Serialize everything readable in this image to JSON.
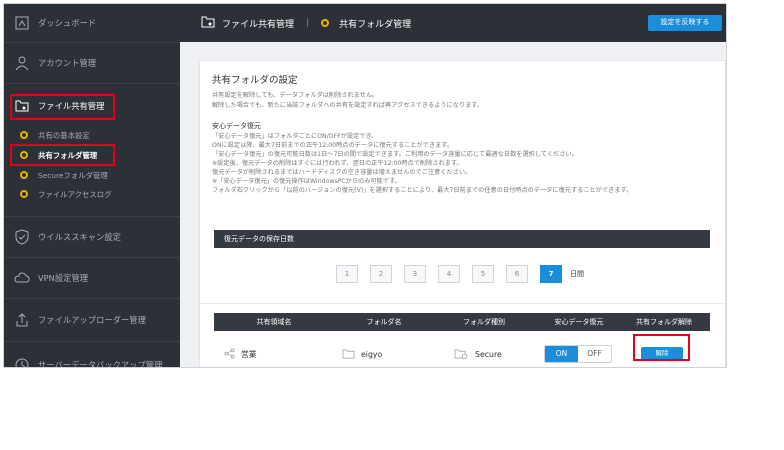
{
  "sidebar": {
    "items": [
      {
        "label": "ダッシュボード",
        "icon": "dashboard-icon"
      },
      {
        "label": "アカウント管理",
        "icon": "user-icon"
      },
      {
        "label": "ファイル共有管理",
        "icon": "folder-share-icon"
      },
      {
        "label": "ウイルススキャン設定",
        "icon": "shield-icon"
      },
      {
        "label": "VPN設定管理",
        "icon": "cloud-icon"
      },
      {
        "label": "ファイルアップローダー管理",
        "icon": "upload-icon"
      },
      {
        "label": "サーバーデータバックアップ管理",
        "icon": "clock-icon"
      }
    ],
    "sub_items": [
      {
        "label": "共有の基本設定"
      },
      {
        "label": "共有フォルダ管理"
      },
      {
        "label": "Secureフォルダ管理"
      },
      {
        "label": "ファイルアクセスログ"
      }
    ]
  },
  "topbar": {
    "title": "ファイル共有管理",
    "separator": "|",
    "subtitle": "共有フォルダ管理",
    "apply_button": "設定を反映する"
  },
  "panel": {
    "title": "共有フォルダの設定",
    "desc1": "共有設定を解除しても、データフォルダは削除されません。",
    "desc2": "解除した場合でも、新たに当該フォルダへの共有を設定すれば再アクセスできるようになります。",
    "subhead": "安心データ復元",
    "notes": [
      "「安心データ復元」はフォルダごとにON/OFFが設定でき、",
      "ONに設定以降、最大7日前までの正午12:00時点のデータに復元することができます。",
      "「安心データ復元」の復元可能日数は1日〜7日の間で設定できます。ご利用のデータ容量に応じて最適な日数を選択してください。",
      "※設定後、復元データの削除はすぐには行われず、翌日の正午12:00時点で削除されます。",
      "復元データが削除されるまではハードディスクの空き容量は増えませんのでご注意ください。",
      "※「安心データ復元」の復元操作はWindowsPCからのみ可能です。",
      "フォルダ右クリックから「以前のバージョンの復元(V)」を選択することにより、最大7日前までの任意の日付時点のデータに復元することができます。"
    ],
    "retention_label": "復元データの保存日数",
    "days": [
      "1",
      "2",
      "3",
      "4",
      "5",
      "6",
      "7"
    ],
    "selected_day": "7",
    "day_unit": "日間"
  },
  "table": {
    "headers": [
      "共有領域名",
      "フォルダ名",
      "フォルダ種別",
      "安心データ復元",
      "共有フォルダ解除"
    ],
    "row": {
      "share_name": "営業",
      "folder_name": "eigyo",
      "folder_type": "Secure",
      "toggle_on": "ON",
      "toggle_off": "OFF",
      "release_button": "解除"
    }
  },
  "colors": {
    "accent": "#1a8ddb",
    "sidebar_bg": "#2c3138",
    "highlight": "#e0001b",
    "dot": "#e6b300"
  }
}
